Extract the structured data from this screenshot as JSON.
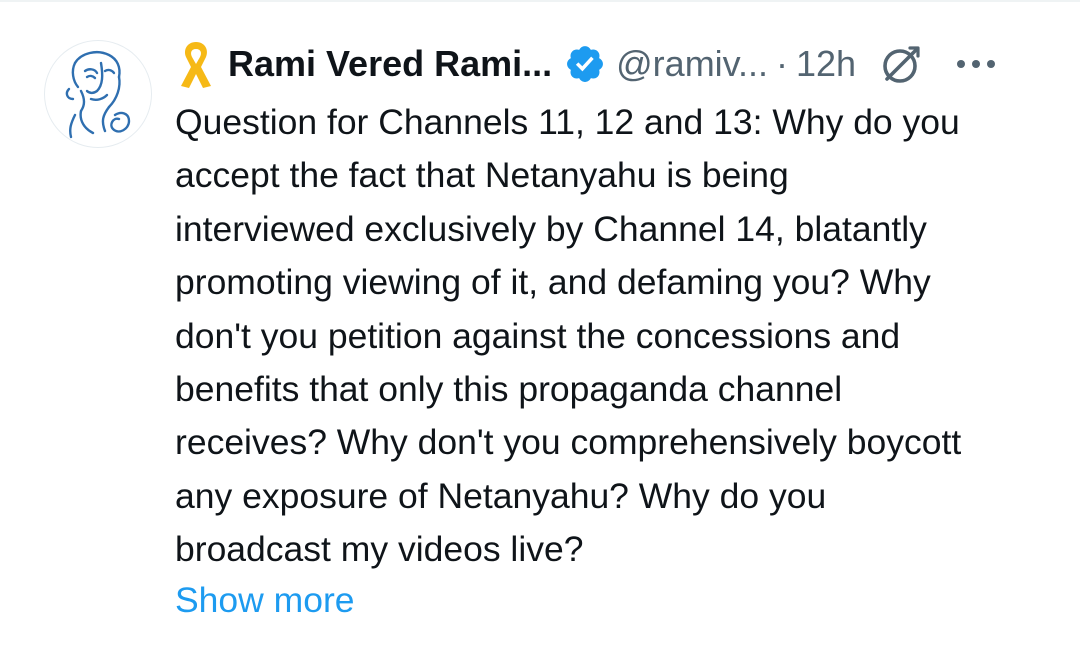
{
  "tweet": {
    "display_name": "Rami Vered Rami...",
    "handle": "@ramiv...",
    "separator": "·",
    "timestamp": "12h",
    "text": "Question for Channels 11, 12 and 13: Why do you\naccept the fact that Netanyahu is being\ninterviewed exclusively by Channel 14, blatantly\npromoting viewing of it, and defaming you? Why\ndon't you petition against the concessions and\nbenefits that only this propaganda channel\nreceives? Why don't you comprehensively boycott\nany exposure of Netanyahu? Why do you\nbroadcast my videos live?",
    "show_more": "Show more",
    "icons": {
      "name_emoji": "yellow-ribbon-icon",
      "verified": "verified-badge-icon",
      "grok": "grok-icon",
      "more": "more-options-icon"
    }
  },
  "colors": {
    "text_primary": "#0f1419",
    "text_secondary": "#536471",
    "link": "#1d9bf0",
    "verified": "#1d9bf0",
    "ribbon": "#f6b916"
  }
}
